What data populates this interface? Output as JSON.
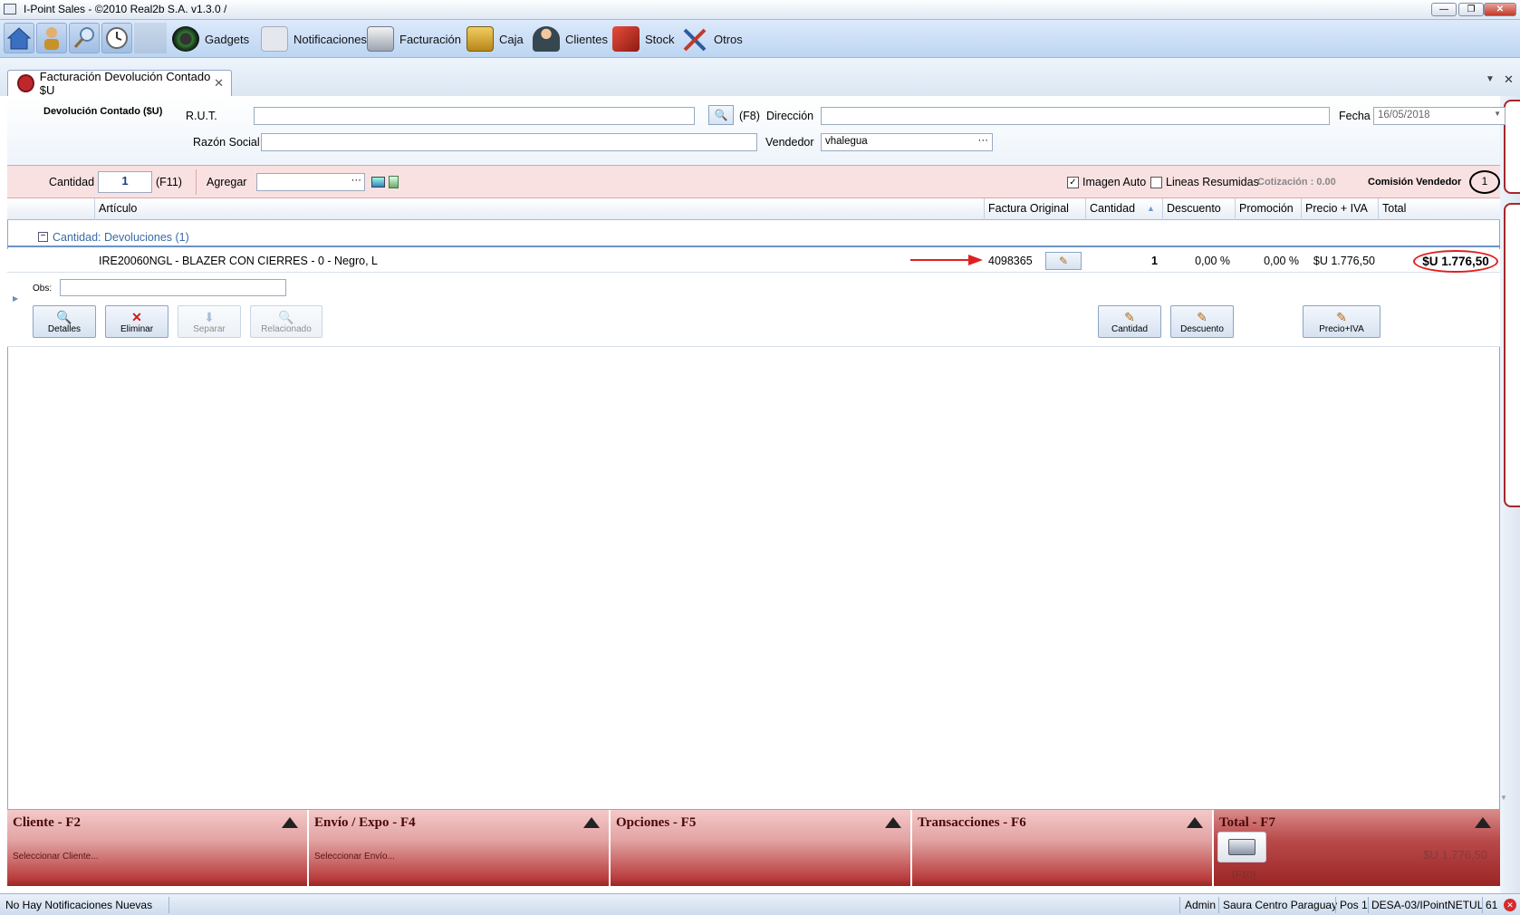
{
  "window": {
    "title": "I-Point Sales  - ©2010 Real2b S.A. v1.3.0 /",
    "minimize": "—",
    "maximize": "❐",
    "close": "✕"
  },
  "toolbar": {
    "quick_icons": [
      "home-icon",
      "users-icon",
      "search-icon",
      "clock-icon"
    ],
    "menu": [
      {
        "label": "Gadgets",
        "icon": "gauge-icon",
        "color": "#2e7d32"
      },
      {
        "label": "Notificaciones",
        "icon": "envelope-icon",
        "color": "#c8ced8"
      },
      {
        "label": "Facturación",
        "icon": "printer-icon",
        "color": "#9aa4b0"
      },
      {
        "label": "Caja",
        "icon": "safe-icon",
        "color": "#d8a72a"
      },
      {
        "label": "Clientes",
        "icon": "client-icon",
        "color": "#37474f"
      },
      {
        "label": "Stock",
        "icon": "boxes-icon",
        "color": "#c0392b"
      },
      {
        "label": "Otros",
        "icon": "tools-icon",
        "color": "#2c5aa0"
      }
    ]
  },
  "tab": {
    "label": "Facturación Devolución Contado $U",
    "close": "✕"
  },
  "tabstrip": {
    "dropdown": "▼",
    "close": "✕"
  },
  "header": {
    "doc_title": "Devolución Contado ($U)",
    "rut_label": "R.U.T.",
    "rut_value": "",
    "f8": "(F8)",
    "direccion_label": "Dirección",
    "direccion_value": "",
    "fecha_label": "Fecha",
    "fecha_value": "16/05/2018",
    "razon_label": "Razón Social",
    "razon_value": "",
    "vendedor_label": "Vendedor",
    "vendedor_value": "vhalegua",
    "ellipsis": "···"
  },
  "addrow": {
    "cantidad_label": "Cantidad",
    "cantidad_value": "1",
    "f11": "(F11)",
    "agregar_label": "Agregar",
    "agregar_value": "",
    "ellipsis": "···",
    "imagen_auto": "Imagen Auto",
    "imagen_auto_checked": true,
    "lineas_resumidas": "Lineas Resumidas",
    "lineas_resumidas_checked": false,
    "cotizacion": "Cotización   : 0.00",
    "comision_label": "Comisión Vendedor",
    "comision_value": "1"
  },
  "grid": {
    "columns": [
      "Artículo",
      "Factura Original",
      "Cantidad",
      "Descuento",
      "Promoción",
      "Precio + IVA",
      "Total"
    ],
    "group_label": "Cantidad: Devoluciones (1)",
    "rows": [
      {
        "articulo": "IRE20060NGL - BLAZER CON CIERRES - 0 - Negro, L",
        "factura": "4098365",
        "cantidad": "1",
        "descuento": "0,00 %",
        "promocion": "0,00 %",
        "precio": "$U 1.776,50",
        "total": "$U 1.776,50"
      }
    ]
  },
  "detail": {
    "obs_label": "Obs:",
    "obs_value": "",
    "buttons": {
      "detalles": "Detalles",
      "eliminar": "Eliminar",
      "separar": "Separar",
      "relacionado": "Relacionado",
      "cantidad": "Cantidad",
      "descuento": "Descuento",
      "precio_iva": "Precio+IVA"
    }
  },
  "bottom": {
    "cliente": {
      "title": "Cliente - F2",
      "sub": "Seleccionar Cliente..."
    },
    "envio": {
      "title": "Envío / Expo - F4",
      "sub": "Seleccionar Envío..."
    },
    "opciones": {
      "title": "Opciones - F5"
    },
    "transacciones": {
      "title": "Transacciones - F6"
    },
    "total": {
      "title": "Total - F7",
      "f10": "(F10)",
      "value": "$U 1.776,50"
    }
  },
  "status": {
    "notif": "No Hay Notificaciones Nuevas",
    "user": "Admin",
    "store": "Saura Centro Paraguay",
    "pos": "Pos 1",
    "terminal": "DESA-03/IPointNETUL",
    "num": "61"
  },
  "colors": {
    "accent_red": "#c0272d",
    "annotation_red": "#e02020",
    "panel_red": "#b93d3d"
  }
}
